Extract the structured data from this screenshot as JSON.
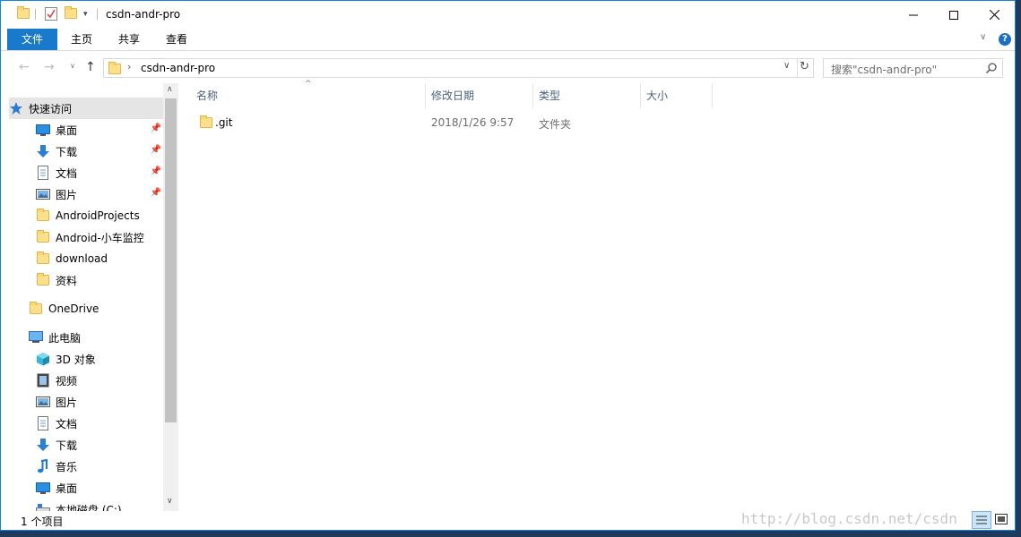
{
  "window": {
    "title": "csdn-andr-pro",
    "controls": {
      "minimize": "—",
      "maximize": "☐",
      "close": "✕"
    }
  },
  "ribbon": {
    "tabs": [
      {
        "label": "文件",
        "active": true
      },
      {
        "label": "主页"
      },
      {
        "label": "共享"
      },
      {
        "label": "查看"
      }
    ],
    "help": "?"
  },
  "address": {
    "path": "csdn-andr-pro",
    "search_placeholder": "搜索\"csdn-andr-pro\""
  },
  "nav": {
    "quick_access": "快速访问",
    "quick_items": [
      {
        "label": "桌面",
        "icon": "desktop-icon",
        "pinned": true
      },
      {
        "label": "下载",
        "icon": "download-icon",
        "pinned": true
      },
      {
        "label": "文档",
        "icon": "document-icon",
        "pinned": true
      },
      {
        "label": "图片",
        "icon": "pictures-icon",
        "pinned": true
      },
      {
        "label": "AndroidProjects",
        "icon": "folder-icon"
      },
      {
        "label": "Android-小车监控",
        "icon": "folder-icon"
      },
      {
        "label": "download",
        "icon": "folder-icon"
      },
      {
        "label": "资料",
        "icon": "folder-icon"
      }
    ],
    "onedrive": "OneDrive",
    "this_pc": "此电脑",
    "pc_items": [
      {
        "label": "3D 对象",
        "icon": "3d-objects-icon"
      },
      {
        "label": "视频",
        "icon": "videos-icon"
      },
      {
        "label": "图片",
        "icon": "pictures-icon"
      },
      {
        "label": "文档",
        "icon": "document-icon"
      },
      {
        "label": "下载",
        "icon": "download-icon"
      },
      {
        "label": "音乐",
        "icon": "music-icon"
      },
      {
        "label": "桌面",
        "icon": "desktop-icon"
      },
      {
        "label": "本地磁盘 (C:)",
        "icon": "drive-icon"
      }
    ]
  },
  "columns": [
    "名称",
    "修改日期",
    "类型",
    "大小"
  ],
  "files": [
    {
      "name": ".git",
      "modified": "2018/1/26 9:57",
      "type": "文件夹",
      "size": ""
    }
  ],
  "status": {
    "count": "1 个项目"
  },
  "watermark": "http://blog.csdn.net/csdn"
}
